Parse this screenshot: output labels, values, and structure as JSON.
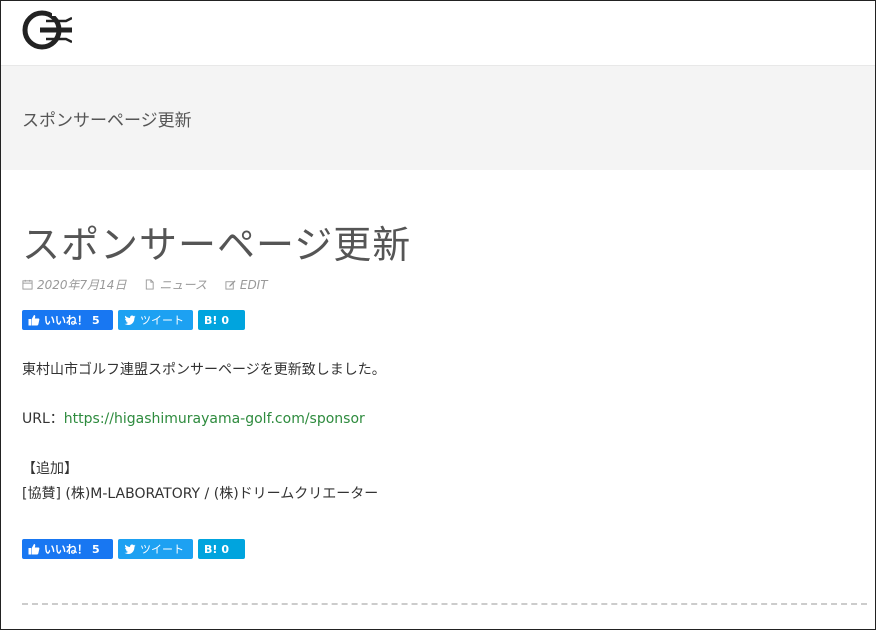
{
  "page_band": {
    "title": "スポンサーページ更新"
  },
  "post": {
    "title": "スポンサーページ更新",
    "date": "2020年7月14日",
    "category": "ニュース",
    "edit_label": "EDIT"
  },
  "share": {
    "like_label": "いいね！",
    "like_count": "5",
    "tweet_label": "ツイート",
    "hatena_label": "B!",
    "hatena_count": "0"
  },
  "content": {
    "paragraph1": "東村山市ゴルフ連盟スポンサーページを更新致しました。",
    "url_label": "URL：",
    "url_link": "https://higashimurayama-golf.com/sponsor",
    "added_heading": "【追加】",
    "added_text": "[協賛] (株)M-LABORATORY / (株)ドリームクリエーター"
  },
  "colors": {
    "like": "#1877f2",
    "tweet": "#1da1f2",
    "hatena": "#00a4de",
    "link": "#2e8b3e"
  }
}
